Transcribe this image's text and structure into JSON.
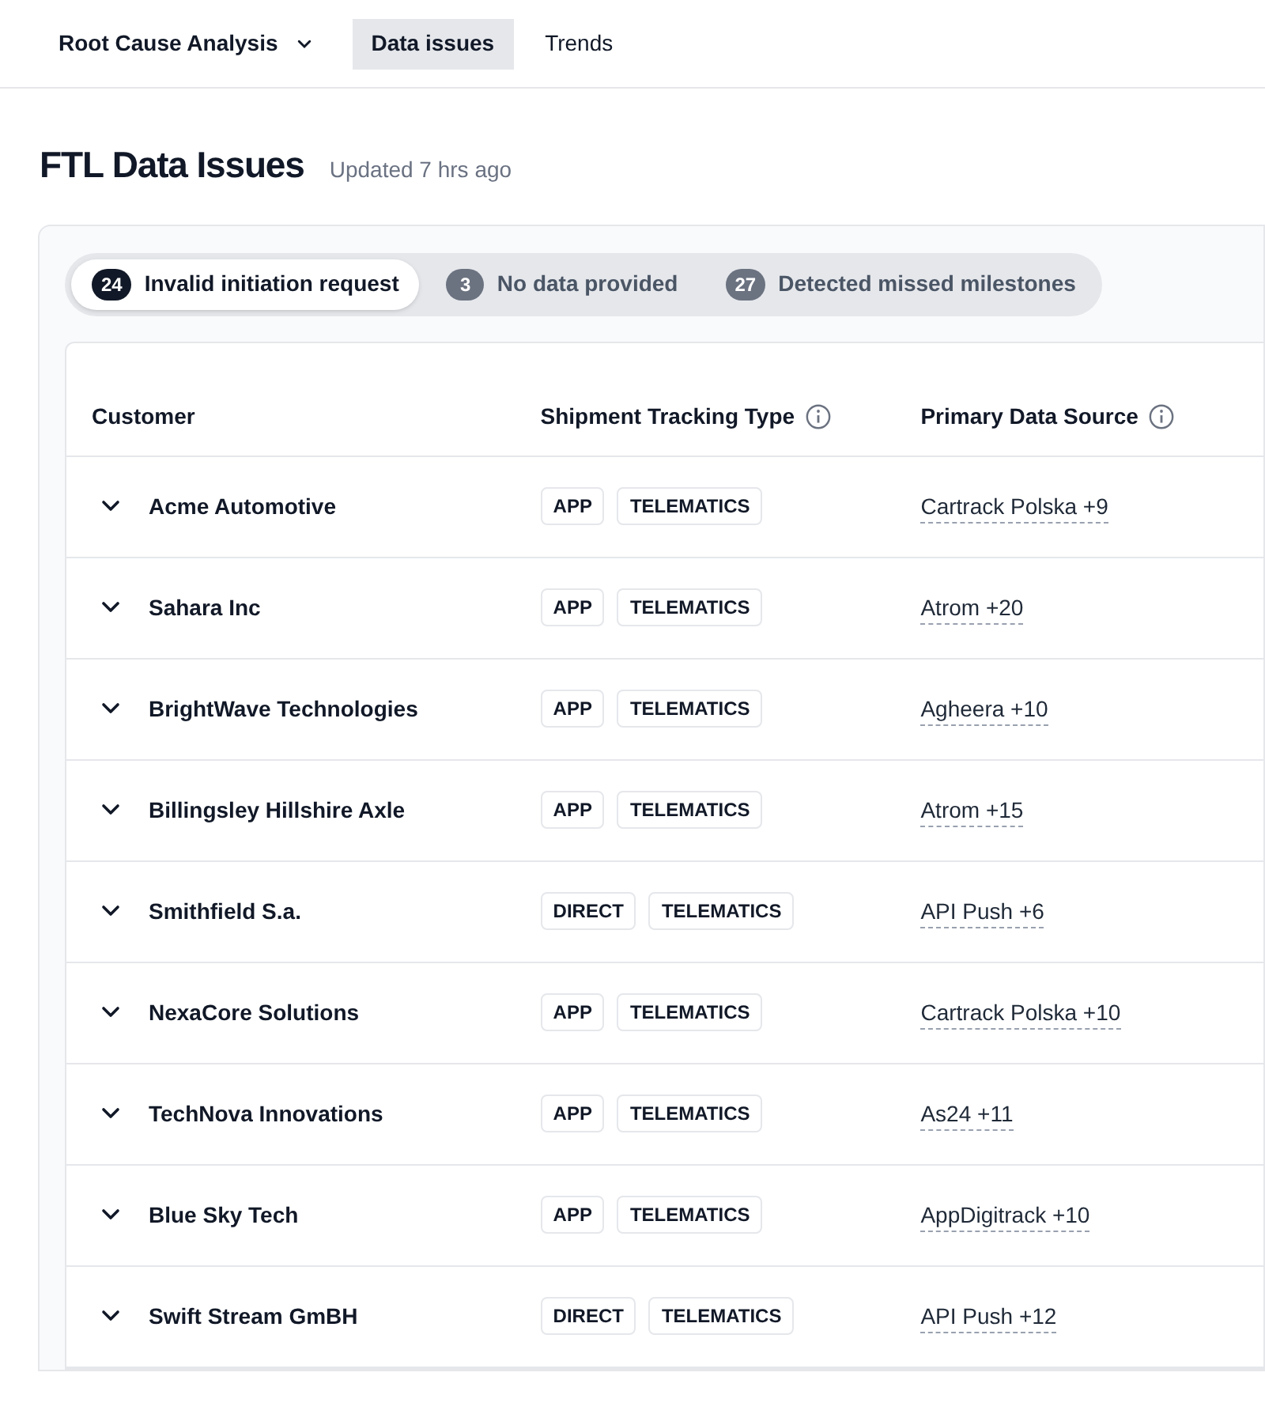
{
  "nav": {
    "menu": {
      "label": "Root Cause Analysis"
    },
    "tabs": [
      {
        "label": "Data issues",
        "selected": true
      },
      {
        "label": "Trends",
        "selected": false
      }
    ]
  },
  "header": {
    "title": "FTL Data Issues",
    "updated": "Updated 7 hrs ago"
  },
  "filters": [
    {
      "count": "24",
      "label": "Invalid initiation request",
      "selected": true
    },
    {
      "count": "3",
      "label": "No data provided",
      "selected": false
    },
    {
      "count": "27",
      "label": "Detected missed milestones",
      "selected": false
    }
  ],
  "table": {
    "columns": [
      {
        "label": "Customer",
        "info": false
      },
      {
        "label": "Shipment Tracking Type",
        "info": true
      },
      {
        "label": "Primary Data Source",
        "info": true
      }
    ],
    "rows": [
      {
        "customer": "Acme Automotive",
        "expanded": false,
        "types": [
          "APP",
          "TELEMATICS"
        ],
        "source": "Cartrack Polska +9"
      },
      {
        "customer": "Sahara Inc",
        "expanded": false,
        "types": [
          "APP",
          "TELEMATICS"
        ],
        "source": "Atrom +20"
      },
      {
        "customer": "BrightWave Technologies",
        "expanded": false,
        "types": [
          "APP",
          "TELEMATICS"
        ],
        "source": "Agheera +10"
      },
      {
        "customer": "Billingsley Hillshire Axle",
        "expanded": false,
        "types": [
          "APP",
          "TELEMATICS"
        ],
        "source": "Atrom +15"
      },
      {
        "customer": "Smithfield S.a.",
        "expanded": false,
        "types": [
          "DIRECT",
          "TELEMATICS"
        ],
        "source": "API Push +6"
      },
      {
        "customer": "NexaCore Solutions",
        "expanded": false,
        "types": [
          "APP",
          "TELEMATICS"
        ],
        "source": "Cartrack Polska +10"
      },
      {
        "customer": "TechNova Innovations",
        "expanded": false,
        "types": [
          "APP",
          "TELEMATICS"
        ],
        "source": "As24 +11"
      },
      {
        "customer": "Blue Sky Tech",
        "expanded": false,
        "types": [
          "APP",
          "TELEMATICS"
        ],
        "source": "AppDigitrack +10"
      },
      {
        "customer": "Swift Stream GmBH",
        "expanded": false,
        "types": [
          "DIRECT",
          "TELEMATICS"
        ],
        "source": "API Push +12"
      }
    ]
  }
}
